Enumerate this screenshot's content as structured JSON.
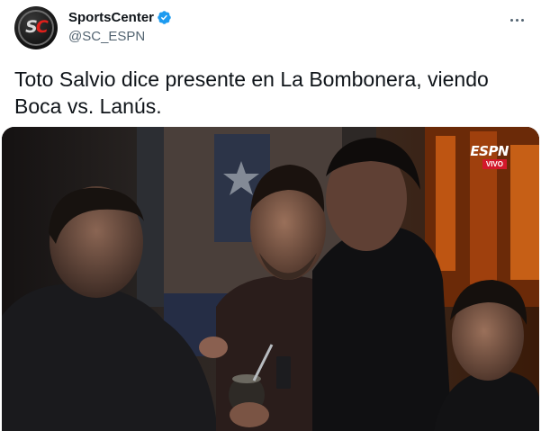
{
  "account": {
    "display_name": "SportsCenter",
    "handle": "@SC_ESPN",
    "avatar_letters_1": "S",
    "avatar_letters_2": "C",
    "verified": true
  },
  "tweet": {
    "text": "Toto Salvio dice presente en La Bombonera, viendo Boca vs. Lanús."
  },
  "media": {
    "broadcast_logo": "ESPN",
    "live_badge": "VIVO"
  },
  "icons": {
    "more": "more-options-icon",
    "verified": "verified-badge-icon"
  },
  "colors": {
    "text_primary": "#0f1419",
    "text_secondary": "#536471",
    "verified_blue": "#1d9bf0",
    "espn_red": "#d3182b"
  }
}
